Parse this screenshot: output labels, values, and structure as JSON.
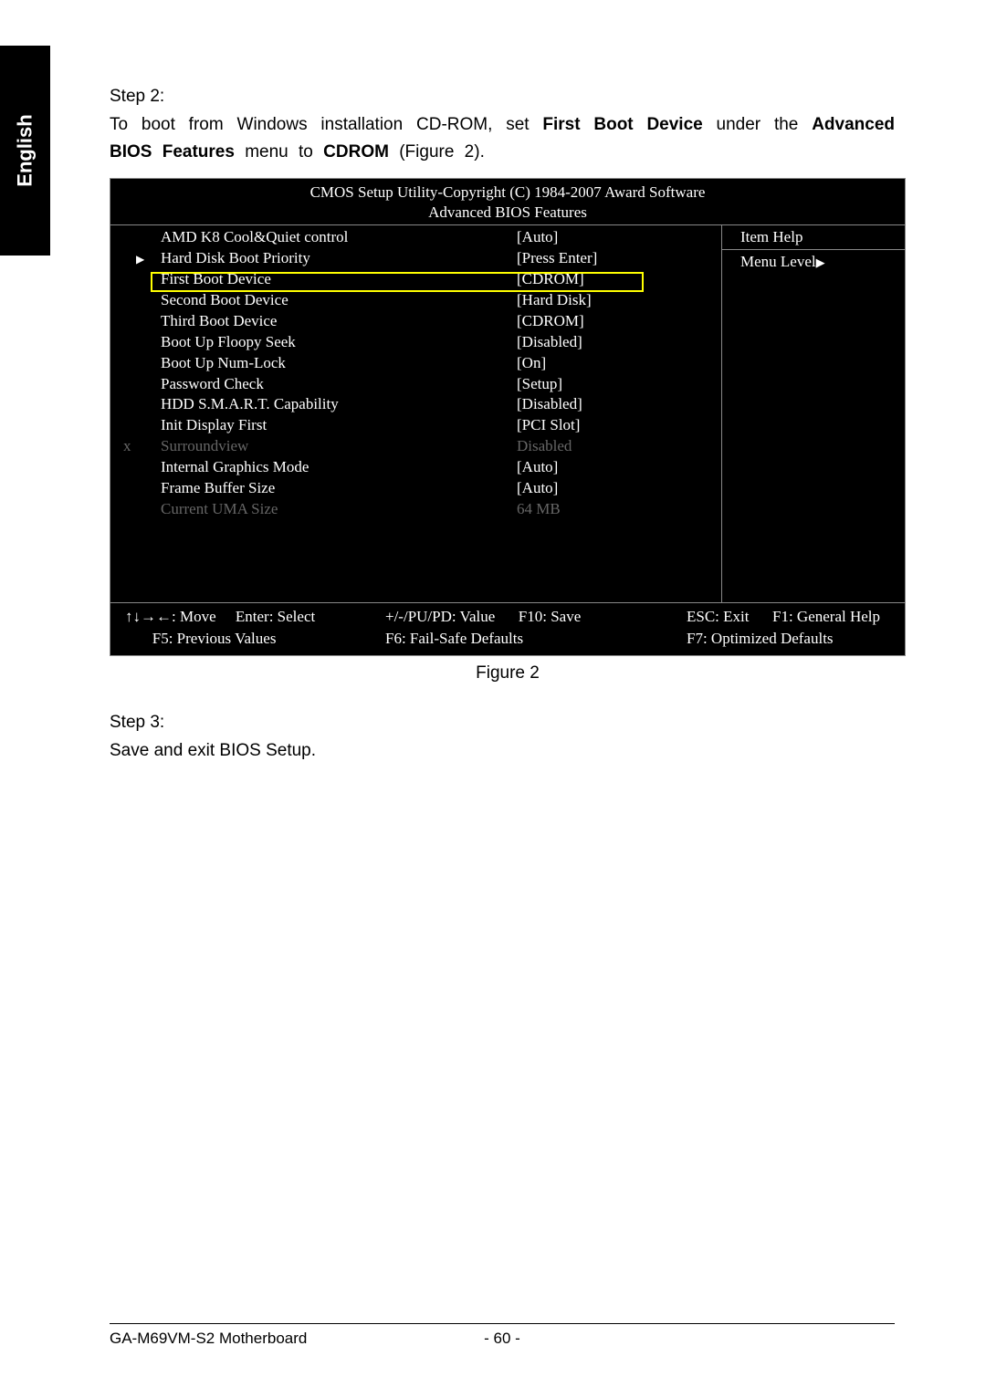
{
  "side_tab": "English",
  "step2": {
    "heading": "Step 2:",
    "instr_pre": "To boot from Windows installation CD-ROM, set ",
    "bold1": "First Boot Device",
    "instr_mid1": " under the ",
    "bold2": "Advanced BIOS Features",
    "instr_mid2": " menu to ",
    "bold3": "CDROM",
    "instr_end": " (Figure 2)."
  },
  "bios": {
    "header1": "CMOS Setup Utility-Copyright (C) 1984-2007 Award Software",
    "header2": "Advanced BIOS Features",
    "help_title": "Item Help",
    "help_level": "Menu Level",
    "rows": [
      {
        "label": "AMD K8 Cool&Quiet control",
        "value": "[Auto]",
        "dim": false
      },
      {
        "label": "Hard Disk Boot Priority",
        "value": "[Press Enter]",
        "dim": false,
        "arrow": true
      },
      {
        "label": "First Boot Device",
        "value": "[CDROM]",
        "dim": false
      },
      {
        "label": "Second Boot Device",
        "value": "[Hard Disk]",
        "dim": false
      },
      {
        "label": "Third Boot Device",
        "value": "[CDROM]",
        "dim": false
      },
      {
        "label": "Boot Up Floopy Seek",
        "value": "[Disabled]",
        "dim": false
      },
      {
        "label": "Boot Up Num-Lock",
        "value": "[On]",
        "dim": false
      },
      {
        "label": "Password Check",
        "value": "[Setup]",
        "dim": false
      },
      {
        "label": "HDD S.M.A.R.T. Capability",
        "value": "[Disabled]",
        "dim": false
      },
      {
        "label": "Init Display First",
        "value": "[PCI Slot]",
        "dim": false
      },
      {
        "label": "Surroundview",
        "value": "Disabled",
        "dim": true,
        "x": true
      },
      {
        "label": "Internal Graphics Mode",
        "value": "[Auto]",
        "dim": false
      },
      {
        "label": "Frame Buffer Size",
        "value": "[Auto]",
        "dim": false
      },
      {
        "label": "Current UMA Size",
        "value": "64 MB",
        "dim": true
      }
    ],
    "footer": {
      "move": "↑↓→←: Move",
      "select": "Enter: Select",
      "value": "+/-/PU/PD: Value",
      "save": "F10: Save",
      "exit": "ESC: Exit",
      "help": "F1: General Help",
      "prev": "F5: Previous Values",
      "failsafe": "F6: Fail-Safe Defaults",
      "optimized": "F7: Optimized Defaults"
    }
  },
  "figure_caption": "Figure 2",
  "step3": {
    "heading": "Step 3:",
    "text": "Save and exit BIOS Setup."
  },
  "footer": {
    "left": "GA-M69VM-S2 Motherboard",
    "center": "- 60 -"
  }
}
